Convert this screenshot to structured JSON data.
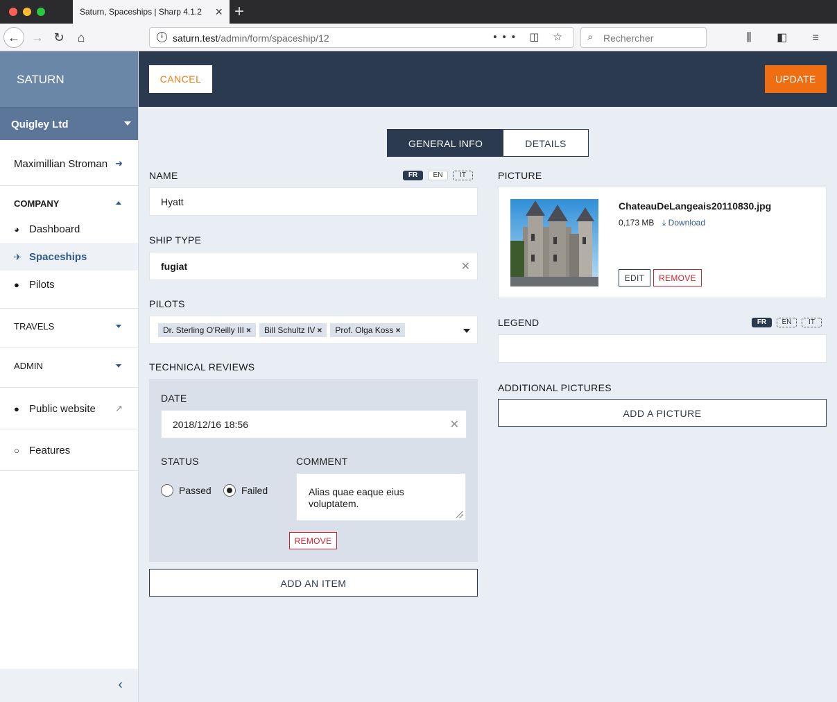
{
  "browser": {
    "tab_title": "Saturn, Spaceships | Sharp 4.1.2",
    "url_host": "saturn.test",
    "url_path": "/admin/form/spaceship/12",
    "search_placeholder": "Rechercher"
  },
  "sidebar": {
    "brand": "SATURN",
    "account": "Quigley Ltd",
    "user": "Maximillian Stroman",
    "groups": [
      {
        "label": "COMPANY",
        "items": [
          {
            "label": "Dashboard",
            "icon": "dashboard-icon"
          },
          {
            "label": "Spaceships",
            "icon": "spaceship-icon",
            "active": true
          },
          {
            "label": "Pilots",
            "icon": "user-icon"
          }
        ]
      },
      {
        "label": "TRAVELS"
      },
      {
        "label": "ADMIN"
      }
    ],
    "public_website": "Public website",
    "features": "Features"
  },
  "actions": {
    "cancel": "CANCEL",
    "update": "UPDATE"
  },
  "tabs": [
    "GENERAL INFO",
    "DETAILS"
  ],
  "locales": [
    "FR",
    "EN",
    "IT"
  ],
  "form": {
    "name": {
      "label": "NAME",
      "value": "Hyatt"
    },
    "ship_type": {
      "label": "SHIP TYPE",
      "value": "fugiat"
    },
    "pilots": {
      "label": "PILOTS",
      "tags": [
        "Dr. Sterling O'Reilly III",
        "Bill Schultz IV",
        "Prof. Olga Koss"
      ]
    },
    "technical_reviews": {
      "label": "TECHNICAL REVIEWS",
      "date_label": "DATE",
      "date_value": "2018/12/16 18:56",
      "status_label": "STATUS",
      "status_options": [
        "Passed",
        "Failed"
      ],
      "status_selected": "Failed",
      "comment_label": "COMMENT",
      "comment_value": "Alias quae eaque eius voluptatem.",
      "remove": "REMOVE",
      "add_item": "ADD AN ITEM"
    },
    "picture": {
      "label": "PICTURE",
      "file_name": "ChateauDeLangeais20110830.jpg",
      "file_size": "0,173 MB",
      "download": "Download",
      "edit": "EDIT",
      "remove": "REMOVE"
    },
    "legend": {
      "label": "LEGEND",
      "value": ""
    },
    "additional_pictures": {
      "label": "ADDITIONAL PICTURES",
      "add": "ADD A PICTURE"
    }
  },
  "colors": {
    "sidebar_brand": "#6a87a8",
    "actionbar": "#2b3a4f",
    "update_button": "#f06e12",
    "cancel_text": "#f07c14",
    "remove_red": "#d0202e",
    "link_blue": "#2e5b8a"
  }
}
